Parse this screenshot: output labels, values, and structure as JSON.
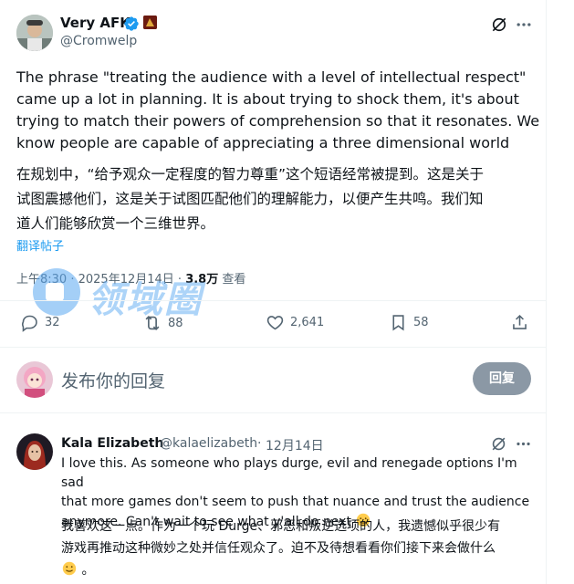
{
  "tweet": {
    "author_name": "Very AFK",
    "author_handle": "@Cromwelp",
    "text_en_lines": [
      "The phrase \"treating the audience with a level of intellectual respect\"",
      "came up a lot in planning. It is about trying to shock them, it's about",
      "trying to match their powers of comprehension so that it resonates. We",
      "know people are capable of appreciating a three dimensional world"
    ],
    "text_zh_lines": [
      "在规划中，“给予观众一定程度的智力尊重”这个短语经常被提到。这是关于",
      "试图震撼他们，这是关于试图匹配他们的理解能力，以便产生共鸣。我们知",
      "道人们能够欣赏一个三维世界。"
    ],
    "translate_label": "翻译帖子",
    "time": "上午8:30",
    "date": "2025年12月14日",
    "views_count": "3.8万",
    "views_label": "查看",
    "replies": "32",
    "reposts": "88",
    "likes": "2,641",
    "bookmarks": "58"
  },
  "compose": {
    "placeholder": "发布你的回复",
    "button_label": "回复"
  },
  "reply": {
    "author_name": "Kala Elizabeth",
    "author_handle": "@kalaelizabeth",
    "date": "12月14日",
    "text_en_lines": [
      "I love this. As someone who plays durge, evil and renegade options I'm sad",
      "that more games don't seem to push that nuance and trust the audience",
      "anymore. Can't wait to see what y'all do next"
    ],
    "text_zh_lines": [
      "我喜欢这一点。作为一个玩 Durge、邪恶和叛逆选项的人，我遗憾似乎很少有",
      "游戏再推动这种微妙之处并信任观众了。迫不及待想看看你们接下来会做什么"
    ],
    "zh_trailing": "。"
  },
  "watermark_text": "领域圈",
  "colors": {
    "accent": "#1d9bf0",
    "verified": "#1d9bf0",
    "muted": "#536471",
    "button_disabled": "#8b98a5"
  }
}
